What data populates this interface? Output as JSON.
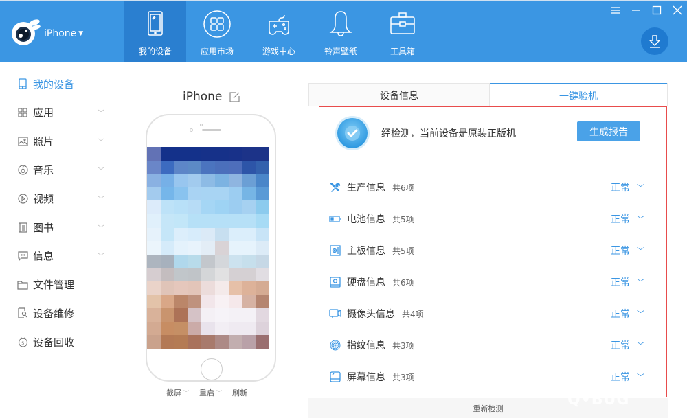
{
  "header": {
    "device_name": "iPhone",
    "nav": [
      {
        "label": "我的设备",
        "icon": "tablet-icon",
        "active": true
      },
      {
        "label": "应用市场",
        "icon": "apps-grid-icon",
        "active": false
      },
      {
        "label": "游戏中心",
        "icon": "gamepad-icon",
        "active": false
      },
      {
        "label": "铃声壁纸",
        "icon": "bell-icon",
        "active": false
      },
      {
        "label": "工具箱",
        "icon": "toolbox-icon",
        "active": false
      }
    ],
    "window_controls": [
      "menu-icon",
      "minimize-icon",
      "maximize-icon",
      "close-icon"
    ],
    "download_icon": "download-icon"
  },
  "sidebar": {
    "items": [
      {
        "label": "我的设备",
        "icon": "phone-icon",
        "active": true,
        "expandable": false
      },
      {
        "label": "应用",
        "icon": "apps-icon",
        "active": false,
        "expandable": true
      },
      {
        "label": "照片",
        "icon": "photo-icon",
        "active": false,
        "expandable": true
      },
      {
        "label": "音乐",
        "icon": "music-icon",
        "active": false,
        "expandable": true
      },
      {
        "label": "视频",
        "icon": "video-icon",
        "active": false,
        "expandable": true
      },
      {
        "label": "图书",
        "icon": "book-icon",
        "active": false,
        "expandable": true
      },
      {
        "label": "信息",
        "icon": "message-icon",
        "active": false,
        "expandable": true
      },
      {
        "label": "文件管理",
        "icon": "folder-icon",
        "active": false,
        "expandable": false
      },
      {
        "label": "设备维修",
        "icon": "repair-icon",
        "active": false,
        "expandable": false
      },
      {
        "label": "设备回收",
        "icon": "recycle-money-icon",
        "active": false,
        "expandable": false
      }
    ]
  },
  "device": {
    "title": "iPhone",
    "actions": [
      {
        "label": "截屏",
        "dropdown": true
      },
      {
        "label": "重启",
        "dropdown": true
      },
      {
        "label": "刷新",
        "dropdown": false
      }
    ]
  },
  "tabs": [
    {
      "label": "设备信息",
      "active": false
    },
    {
      "label": "一键验机",
      "active": true
    }
  ],
  "verify": {
    "result_text": "经检测，当前设备是原装正版机",
    "report_button": "生成报告",
    "items": [
      {
        "name": "生产信息",
        "count": "共6项",
        "status": "正常",
        "icon": "tools-icon"
      },
      {
        "name": "电池信息",
        "count": "共5项",
        "status": "正常",
        "icon": "battery-icon"
      },
      {
        "name": "主板信息",
        "count": "共5项",
        "status": "正常",
        "icon": "motherboard-icon"
      },
      {
        "name": "硬盘信息",
        "count": "共6项",
        "status": "正常",
        "icon": "disk-icon"
      },
      {
        "name": "摄像头信息",
        "count": "共4项",
        "status": "正常",
        "icon": "camera-icon"
      },
      {
        "name": "指纹信息",
        "count": "共3项",
        "status": "正常",
        "icon": "fingerprint-icon"
      },
      {
        "name": "屏幕信息",
        "count": "共3项",
        "status": "正常",
        "icon": "screen-icon"
      }
    ],
    "recheck_label": "重新检测"
  },
  "watermark": "Q•BUG",
  "colors": {
    "primary": "#3b96e3",
    "nav_active": "#2a7fd0",
    "highlight_border": "#e84c4c",
    "button": "#4aa2e8"
  }
}
